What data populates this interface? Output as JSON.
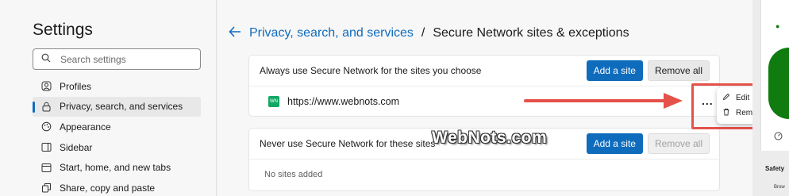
{
  "sidebar": {
    "title": "Settings",
    "search_placeholder": "Search settings",
    "items": [
      {
        "label": "Profiles",
        "icon": "profile-icon",
        "active": false
      },
      {
        "label": "Privacy, search, and services",
        "icon": "lock-icon",
        "active": true
      },
      {
        "label": "Appearance",
        "icon": "appearance-icon",
        "active": false
      },
      {
        "label": "Sidebar",
        "icon": "sidebar-icon",
        "active": false
      },
      {
        "label": "Start, home, and new tabs",
        "icon": "home-icon",
        "active": false
      },
      {
        "label": "Share, copy and paste",
        "icon": "share-icon",
        "active": false
      }
    ]
  },
  "header": {
    "breadcrumb_link": "Privacy, search, and services",
    "separator": "/",
    "current": "Secure Network sites & exceptions"
  },
  "always_section": {
    "title": "Always use Secure Network for the sites you choose",
    "add_label": "Add a site",
    "remove_all_label": "Remove all",
    "sites": [
      {
        "url": "https://www.webnots.com",
        "favicon_text": "WN"
      }
    ]
  },
  "never_section": {
    "title": "Never use Secure Network for these sites",
    "add_label": "Add a site",
    "remove_all_label": "Remove all",
    "empty_text": "No sites added"
  },
  "more_label": "...",
  "context_menu": {
    "items": [
      {
        "label": "Edit",
        "icon": "pencil-icon"
      },
      {
        "label": "Remove",
        "icon": "trash-icon"
      }
    ]
  },
  "watermark": "WebNots.com",
  "right_panel": {
    "label": "Safety",
    "sub_label": "Brow"
  },
  "colors": {
    "accent": "#0f6cbd",
    "annotation": "#e5524a",
    "favicon": "#11a866"
  }
}
